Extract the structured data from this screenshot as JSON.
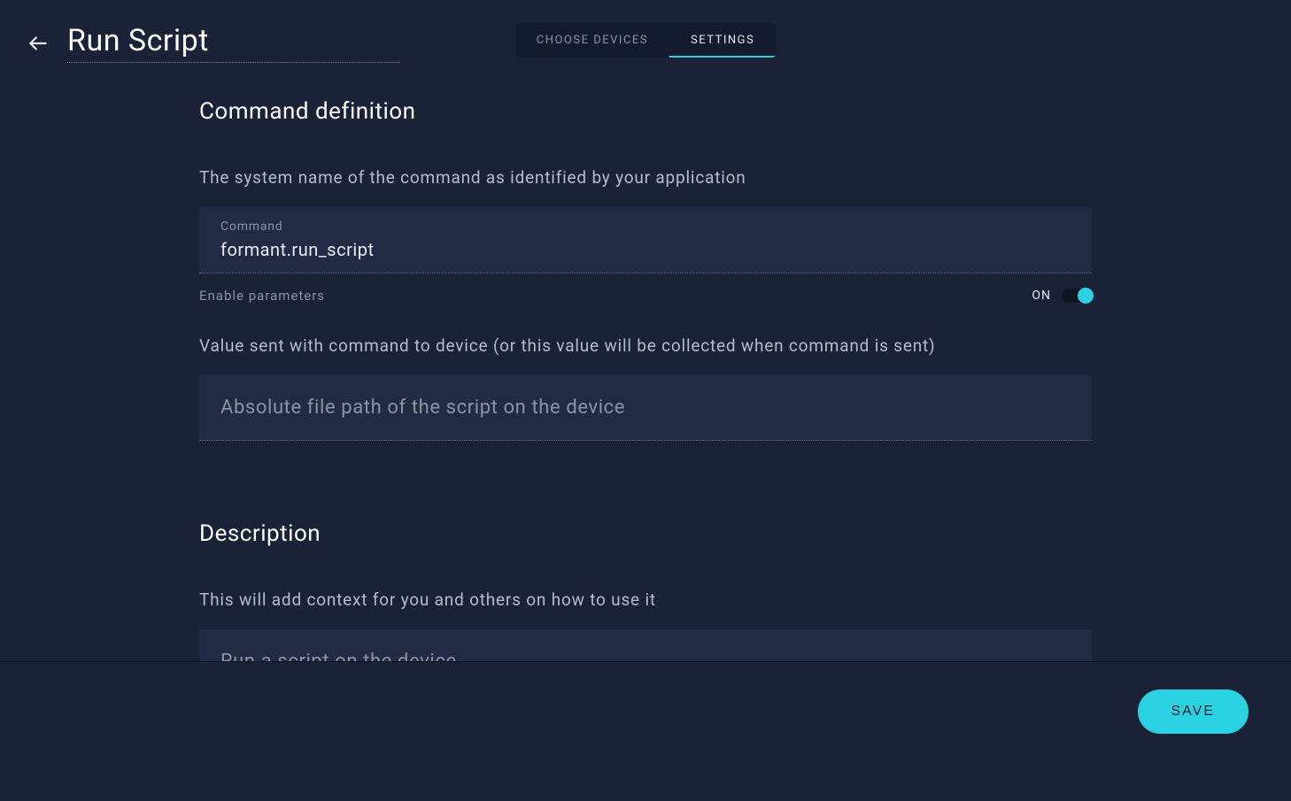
{
  "header": {
    "title": "Run Script",
    "tabs": [
      {
        "label": "CHOOSE DEVICES",
        "active": false
      },
      {
        "label": "SETTINGS",
        "active": true
      }
    ]
  },
  "sections": {
    "command_definition": {
      "title": "Command definition",
      "subtitle": "The system name of the command as identified by your application",
      "command_label": "Command",
      "command_value": "formant.run_script",
      "enable_params_label": "Enable parameters",
      "enable_params_state": "ON",
      "value_subtitle": "Value sent with command to device (or this value will be collected when command is sent)",
      "value_placeholder": "Absolute file path of the script on the device"
    },
    "description": {
      "title": "Description",
      "subtitle": "This will add context for you and others on how to use it",
      "value": "Run a script on the device."
    }
  },
  "footer": {
    "save_label": "SAVE"
  }
}
